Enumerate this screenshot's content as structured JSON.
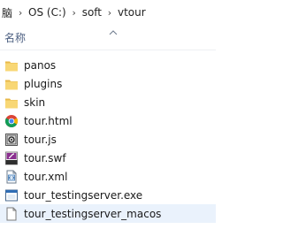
{
  "breadcrumb": {
    "items": [
      "脑",
      "OS (C:)",
      "soft",
      "vtour"
    ],
    "separator": "›"
  },
  "header": {
    "name_label": "名称",
    "sort_icon": "chevron-up-icon"
  },
  "files": [
    {
      "name": "panos",
      "type": "folder",
      "icon": "folder-icon"
    },
    {
      "name": "plugins",
      "type": "folder",
      "icon": "folder-icon"
    },
    {
      "name": "skin",
      "type": "folder",
      "icon": "folder-icon"
    },
    {
      "name": "tour.html",
      "type": "html",
      "icon": "chrome-icon"
    },
    {
      "name": "tour.js",
      "type": "js",
      "icon": "js-file-icon"
    },
    {
      "name": "tour.swf",
      "type": "swf",
      "icon": "swf-file-icon"
    },
    {
      "name": "tour.xml",
      "type": "xml",
      "icon": "xml-file-icon"
    },
    {
      "name": "tour_testingserver.exe",
      "type": "exe",
      "icon": "exe-file-icon"
    },
    {
      "name": "tour_testingserver_macos",
      "type": "file",
      "icon": "blank-file-icon",
      "selected": true
    }
  ],
  "colors": {
    "folder": "#f8d775",
    "folder_dark": "#e8b84a",
    "selection": "#eaf2fc",
    "header_text": "#4d6082"
  }
}
